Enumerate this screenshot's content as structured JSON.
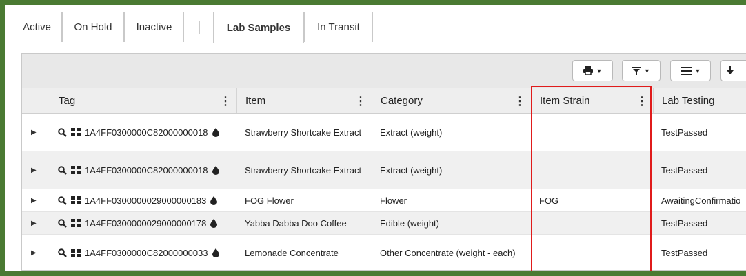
{
  "tabs": [
    {
      "label": "Active"
    },
    {
      "label": "On Hold"
    },
    {
      "label": "Inactive"
    },
    {
      "label": "Lab Samples"
    },
    {
      "label": "In Transit"
    }
  ],
  "toolbar": {
    "print_icon": "printer-icon",
    "filter_icon": "filter-icon",
    "columns_icon": "list-icon",
    "download_icon": "download-icon"
  },
  "columns": [
    "Tag",
    "Item",
    "Category",
    "Item Strain",
    "Lab Testing"
  ],
  "rows": [
    {
      "tag": "1A4FF0300000C82000000018",
      "item": "Strawberry Shortcake Extract",
      "category": "Extract (weight)",
      "strain": "",
      "lab": "TestPassed"
    },
    {
      "tag": "1A4FF0300000C82000000018",
      "item": "Strawberry Shortcake Extract",
      "category": "Extract (weight)",
      "strain": "",
      "lab": "TestPassed"
    },
    {
      "tag": "1A4FF0300000029000000183",
      "item": "FOG Flower",
      "category": "Flower",
      "strain": "FOG",
      "lab": "AwaitingConfirmatio"
    },
    {
      "tag": "1A4FF0300000029000000178",
      "item": "Yabba Dabba Doo Coffee",
      "category": "Edible (weight)",
      "strain": "",
      "lab": "TestPassed"
    },
    {
      "tag": "1A4FF0300000C82000000033",
      "item": "Lemonade Concentrate",
      "category": "Other Concentrate (weight - each)",
      "strain": "",
      "lab": "TestPassed"
    }
  ],
  "colors": {
    "frame": "#4a7a32",
    "highlight": "#e01b1b"
  }
}
